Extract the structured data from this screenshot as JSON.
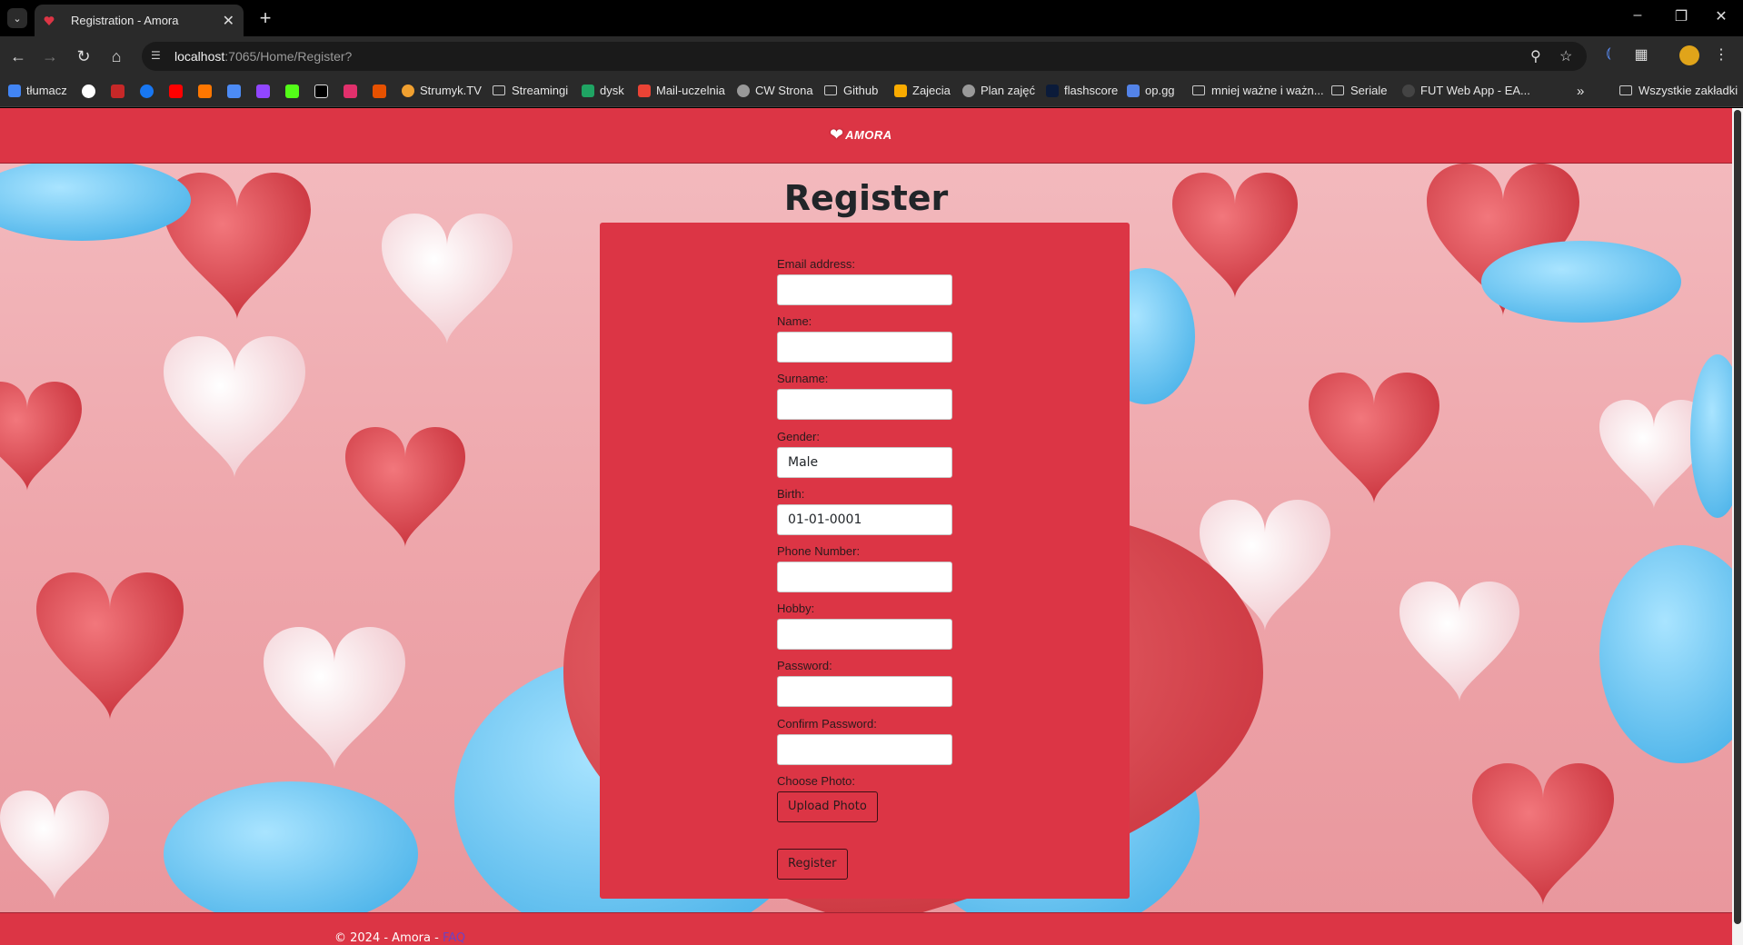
{
  "browser": {
    "tab_title": "Registration - Amora",
    "url_host": "localhost",
    "url_path": ":7065/Home/Register?",
    "bookmarks": [
      {
        "label": "tłumacz",
        "icon": "translate-icon"
      },
      {
        "label": "",
        "icon": "google-icon"
      },
      {
        "label": "",
        "icon": "bookmark-icon"
      },
      {
        "label": "",
        "icon": "facebook-icon"
      },
      {
        "label": "",
        "icon": "youtube-icon"
      },
      {
        "label": "",
        "icon": "soundcloud-icon"
      },
      {
        "label": "",
        "icon": "translate-icon"
      },
      {
        "label": "",
        "icon": "twitch-icon"
      },
      {
        "label": "",
        "icon": "kick-icon"
      },
      {
        "label": "",
        "icon": "x-icon"
      },
      {
        "label": "",
        "icon": "instagram-icon"
      },
      {
        "label": "",
        "icon": "bookmark-icon"
      },
      {
        "label": "Strumyk.TV",
        "icon": "globe-icon"
      },
      {
        "label": "Streamingi",
        "icon": "folder-icon"
      },
      {
        "label": "dysk",
        "icon": "drive-icon"
      },
      {
        "label": "Mail-uczelnia",
        "icon": "gmail-icon"
      },
      {
        "label": "CW Strona",
        "icon": "globe-icon"
      },
      {
        "label": "Github",
        "icon": "folder-icon"
      },
      {
        "label": "Zajecia",
        "icon": "classroom-icon"
      },
      {
        "label": "Plan zajęć",
        "icon": "globe-icon"
      },
      {
        "label": "flashscore",
        "icon": "flashscore-icon"
      },
      {
        "label": "op.gg",
        "icon": "opgg-icon"
      },
      {
        "label": "mniej ważne i ważn...",
        "icon": "folder-icon"
      },
      {
        "label": "Seriale",
        "icon": "folder-icon"
      },
      {
        "label": "FUT Web App - EA...",
        "icon": "ea-icon"
      }
    ],
    "all_bookmarks_label": "Wszystkie zakładki",
    "colors": {
      "chrome_bg": "#2a2a2a",
      "tabbar_bg": "#000000"
    }
  },
  "site": {
    "logo_text": "AMORA",
    "brand_color": "#dc3545"
  },
  "page": {
    "title": "Register"
  },
  "form": {
    "email_label": "Email address:",
    "email_value": "",
    "name_label": "Name:",
    "name_value": "",
    "surname_label": "Surname:",
    "surname_value": "",
    "gender_label": "Gender:",
    "gender_value": "Male",
    "birth_label": "Birth:",
    "birth_value": "01-01-0001",
    "phone_label": "Phone Number:",
    "phone_value": "",
    "hobby_label": "Hobby:",
    "hobby_value": "",
    "password_label": "Password:",
    "password_value": "",
    "confirm_label": "Confirm Password:",
    "confirm_value": "",
    "photo_label": "Choose Photo:",
    "upload_button": "Upload Photo",
    "submit_button": "Register"
  },
  "footer": {
    "copyright": "© 2024 - Amora - ",
    "link_text": "FAQ"
  }
}
